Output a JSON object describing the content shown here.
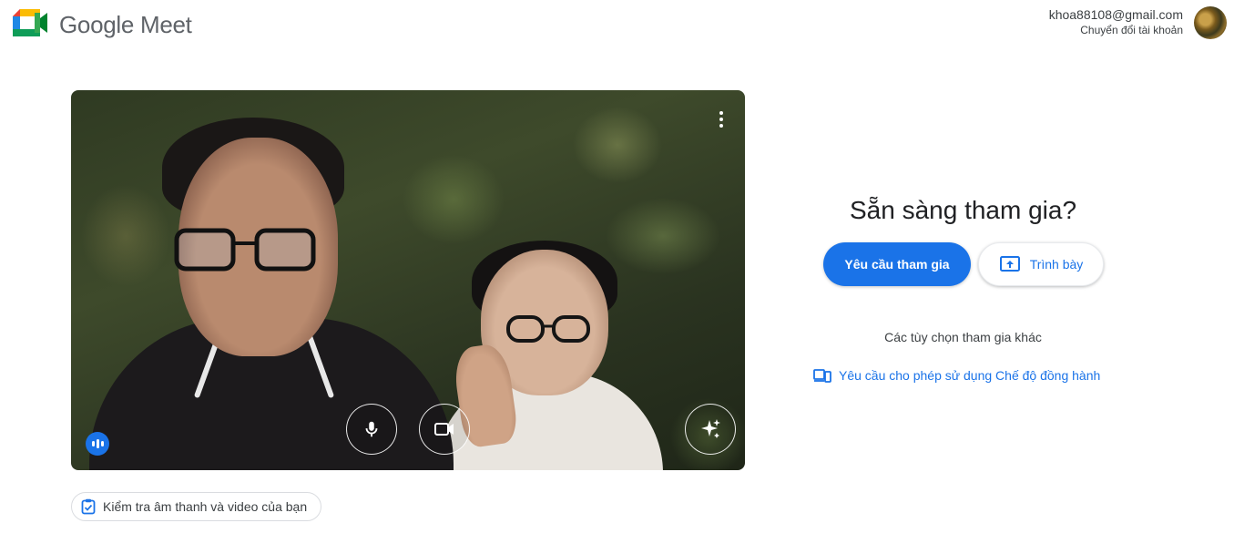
{
  "brand": {
    "name": "Google Meet",
    "logo_icon": "google-meet-logo"
  },
  "account": {
    "email": "khoa88108@gmail.com",
    "switch_label": "Chuyển đổi tài khoản"
  },
  "preview": {
    "controls": {
      "more_icon": "more-vert-icon",
      "audio_indicator_icon": "audio-level-icon",
      "mic_icon": "microphone-icon",
      "camera_icon": "camera-icon",
      "effects_icon": "sparkle-effects-icon"
    }
  },
  "check_chip": {
    "label": "Kiểm tra âm thanh và video của bạn",
    "icon": "clipboard-check-icon"
  },
  "join_panel": {
    "title": "Sẵn sàng tham gia?",
    "join_label": "Yêu cầu tham gia",
    "present_label": "Trình bày",
    "present_icon": "present-screen-icon",
    "other_options_label": "Các tùy chọn tham gia khác",
    "companion_label": "Yêu cầu cho phép sử dụng Chế độ đồng hành",
    "companion_icon": "companion-devices-icon"
  },
  "colors": {
    "accent": "#1a73e8",
    "text": "#202124"
  }
}
